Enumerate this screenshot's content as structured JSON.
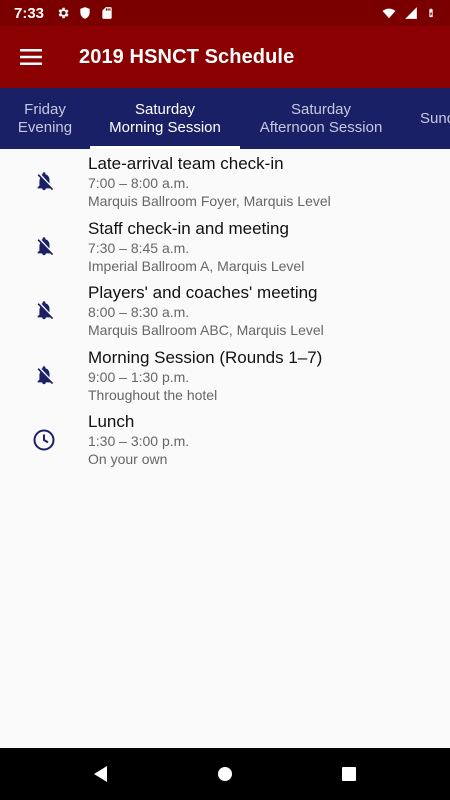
{
  "status_bar": {
    "time": "7:33",
    "icons_left": [
      "gear-icon",
      "shield-icon",
      "sd-card-icon"
    ],
    "icons_right": [
      "wifi-icon",
      "signal-icon",
      "battery-charging-icon"
    ]
  },
  "app_bar": {
    "menu_icon": "hamburger-menu-icon",
    "title": "2019 HSNCT Schedule"
  },
  "tabs": [
    {
      "line1": "Friday",
      "line2": "Evening",
      "active": false
    },
    {
      "line1": "Saturday",
      "line2": "Morning Session",
      "active": true
    },
    {
      "line1": "Saturday",
      "line2": "Afternoon Session",
      "active": false
    },
    {
      "line1": "Sund",
      "line2": "",
      "active": false
    }
  ],
  "events": [
    {
      "title": "Late-arrival team check-in",
      "time": "7:00 – 8:00 a.m.",
      "location": "Marquis Ballroom Foyer, Marquis Level",
      "icon": "bell-off-icon"
    },
    {
      "title": "Staff check-in and meeting",
      "time": "7:30 – 8:45 a.m.",
      "location": "Imperial Ballroom A, Marquis Level",
      "icon": "bell-off-icon"
    },
    {
      "title": "Players' and coaches' meeting",
      "time": "8:00 – 8:30 a.m.",
      "location": "Marquis Ballroom ABC, Marquis Level",
      "icon": "bell-off-icon"
    },
    {
      "title": "Morning Session (Rounds 1–7)",
      "time": "9:00 – 1:30 p.m.",
      "location": "Throughout the hotel",
      "icon": "bell-off-icon"
    },
    {
      "title": "Lunch",
      "time": "1:30 – 3:00 p.m.",
      "location": "On your own",
      "icon": "clock-icon"
    }
  ],
  "nav_bar": {
    "buttons": [
      "back-icon",
      "home-icon",
      "recents-icon"
    ]
  },
  "colors": {
    "status_bar": "#7a0000",
    "app_bar": "#8b0000",
    "tab_bar": "#1a2066",
    "icon_accent": "#1a2066",
    "background": "#fafafa"
  }
}
